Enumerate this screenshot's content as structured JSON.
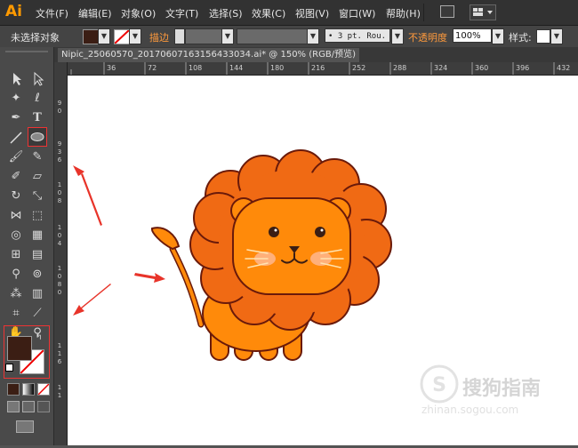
{
  "app": {
    "logo": "Ai"
  },
  "menu": [
    "文件(F)",
    "编辑(E)",
    "对象(O)",
    "文字(T)",
    "选择(S)",
    "效果(C)",
    "视图(V)",
    "窗口(W)",
    "帮助(H)"
  ],
  "control_bar": {
    "selection_status": "未选择对象",
    "stroke_label": "描边",
    "brush_value": "3 pt. Rou.",
    "opacity_label": "不透明度",
    "opacity_value": "100%",
    "style_label": "样式:"
  },
  "document": {
    "tab_title": "Nipic_25060570_20170607163156433034.ai* @ 150% (RGB/预览)"
  },
  "rulers": {
    "horizontal": [
      "36",
      "72",
      "108",
      "144",
      "180",
      "216",
      "252",
      "288",
      "324",
      "360",
      "396",
      "432"
    ],
    "vertical": [
      "9",
      "0",
      "9",
      "3",
      "6",
      "1",
      "0",
      "8",
      "1",
      "0",
      "4",
      "1",
      "0",
      "8",
      "0",
      "1",
      "1",
      "6",
      "1",
      "1"
    ]
  },
  "colors": {
    "fill": "#3b1e14",
    "mane": "#f06a14",
    "mane_outline": "#6a1a0a",
    "body": "#ff8a0a",
    "arrow": "#e8342a"
  },
  "watermark": {
    "text": "搜狗指南",
    "subtext": "zhinan.sogou.com"
  }
}
